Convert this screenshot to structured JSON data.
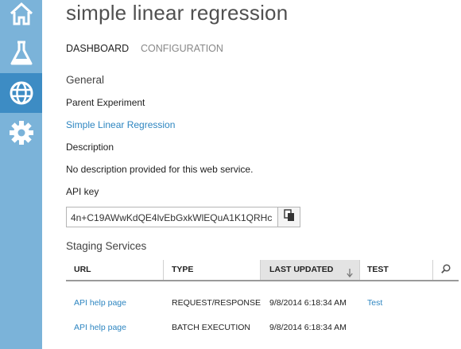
{
  "page": {
    "title": "simple linear regression"
  },
  "tabs": [
    {
      "label": "DASHBOARD",
      "selected": true
    },
    {
      "label": "CONFIGURATION",
      "selected": false
    }
  ],
  "sidebar": {
    "items": [
      {
        "icon": "home-icon"
      },
      {
        "icon": "flask-icon"
      },
      {
        "icon": "globe-icon",
        "selected": true
      },
      {
        "icon": "gear-icon"
      }
    ],
    "active_color": "#3d8cc4",
    "background_color": "#7bb3d9"
  },
  "general": {
    "heading": "General",
    "parent_label": "Parent Experiment",
    "parent_value": "Simple Linear Regression",
    "description_label": "Description",
    "description_value": "No description provided for this web service.",
    "apikey_label": "API key",
    "apikey_value": "4n+C19AWwKdQE4lvEbGxkWlEQuA1K1QRHc"
  },
  "staging": {
    "heading": "Staging Services",
    "columns": [
      "URL",
      "TYPE",
      "LAST UPDATED",
      "TEST"
    ],
    "sorted_column": "LAST UPDATED",
    "sort_direction": "descending",
    "rows": [
      {
        "url": "API help page",
        "type": "REQUEST/RESPONSE",
        "last_updated": "9/8/2014 6:18:34 AM",
        "test": "Test"
      },
      {
        "url": "API help page",
        "type": "BATCH EXECUTION",
        "last_updated": "9/8/2014 6:18:34 AM",
        "test": ""
      }
    ]
  },
  "colors": {
    "link": "#2e86c1"
  }
}
